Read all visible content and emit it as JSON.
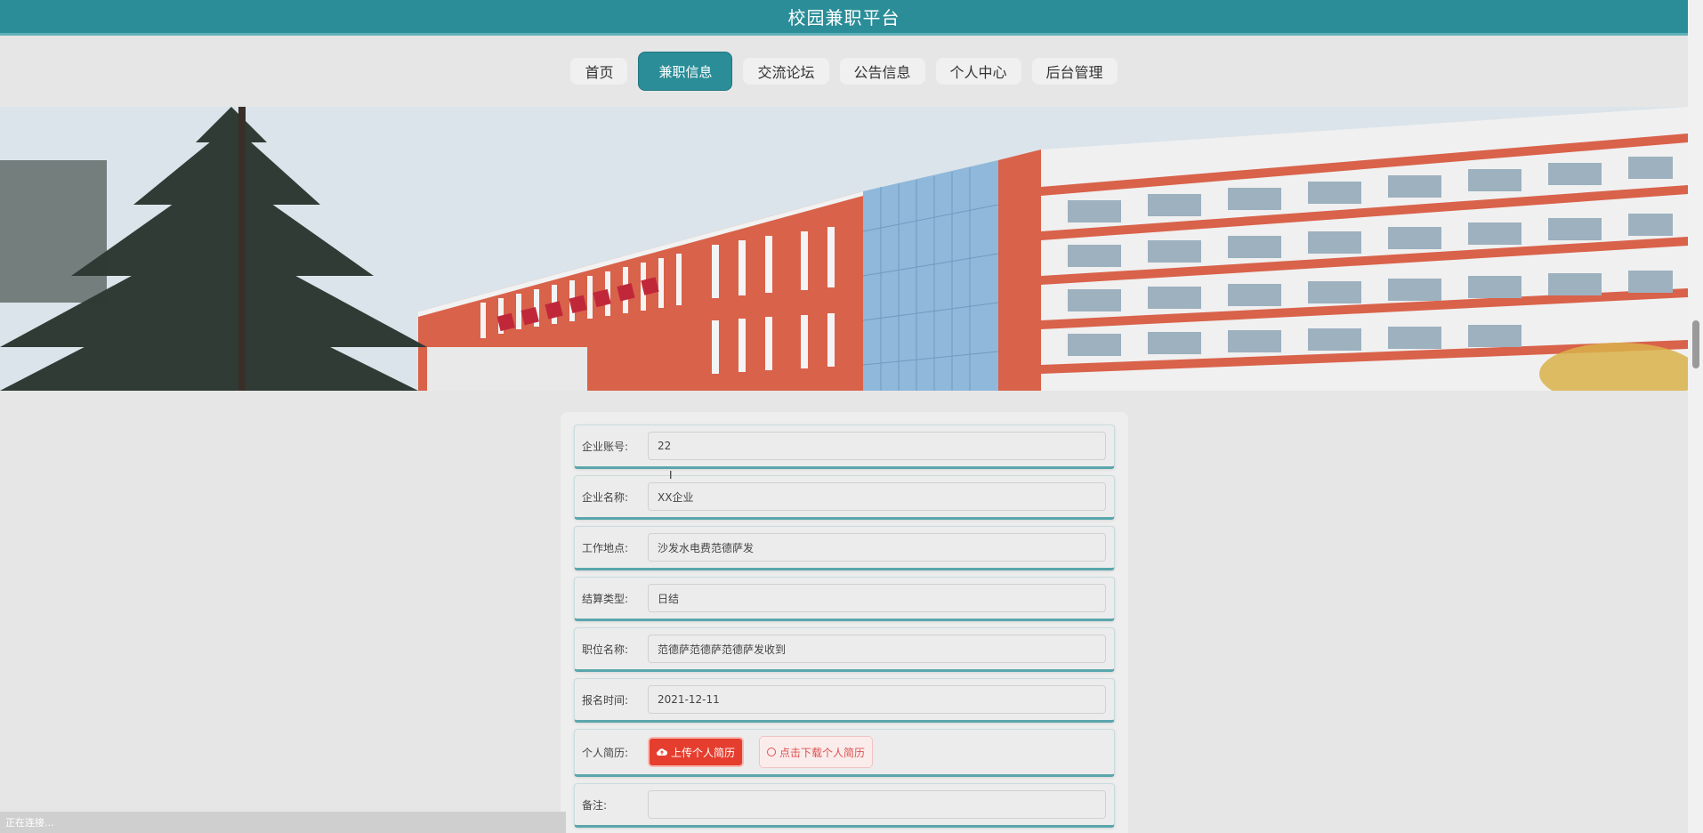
{
  "header": {
    "title": "校园兼职平台"
  },
  "nav": {
    "items": [
      {
        "label": "首页",
        "active": false
      },
      {
        "label": "兼职信息",
        "active": true
      },
      {
        "label": "交流论坛",
        "active": false
      },
      {
        "label": "公告信息",
        "active": false
      },
      {
        "label": "个人中心",
        "active": false
      },
      {
        "label": "后台管理",
        "active": false
      }
    ]
  },
  "banner": {
    "slide_count": 2,
    "active_slide": 1
  },
  "form": {
    "fields": [
      {
        "label": "企业账号:",
        "value": "22"
      },
      {
        "label": "企业名称:",
        "value": "XX企业"
      },
      {
        "label": "工作地点:",
        "value": "沙发水电费范德萨发"
      },
      {
        "label": "结算类型:",
        "value": "日结"
      },
      {
        "label": "职位名称:",
        "value": "范德萨范德萨范德萨发收到"
      },
      {
        "label": "报名时间:",
        "value": "2021-12-11"
      }
    ],
    "resume": {
      "label": "个人简历:",
      "upload_button": "上传个人简历",
      "download_button": "点击下载个人简历"
    },
    "remark": {
      "label": "备注:",
      "value": ""
    }
  },
  "status_bar": {
    "text": "正在连接..."
  },
  "colors": {
    "primary": "#2a8d98",
    "upload": "#e53e2e",
    "download": "#d9534f"
  }
}
